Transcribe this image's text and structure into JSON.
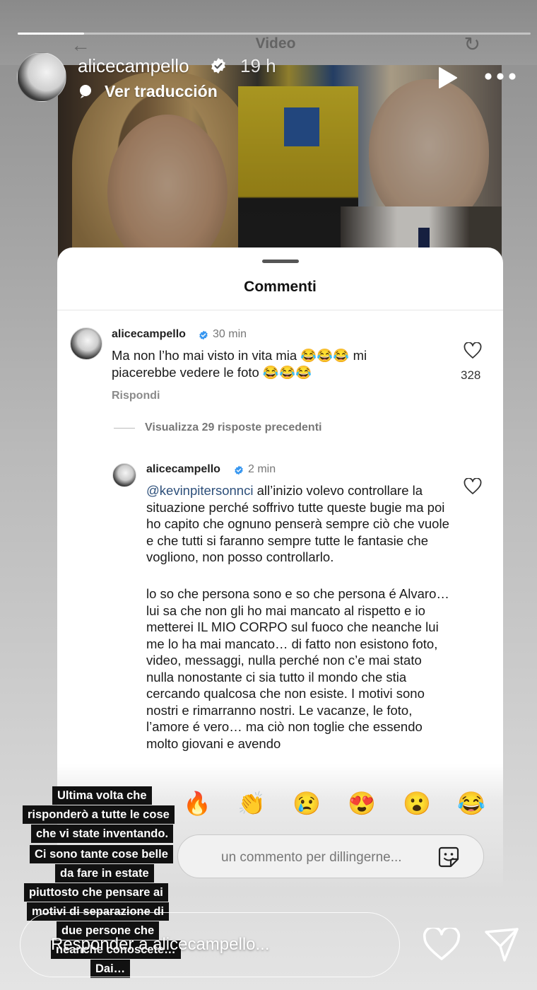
{
  "story": {
    "progress": 0.13,
    "video_label": "Video",
    "username": "alicecampello",
    "time": "19 h",
    "translate_label": "Ver traducción"
  },
  "comments_sheet": {
    "title": "Commenti",
    "comment1": {
      "username": "alicecampello",
      "time": "30 min",
      "text": "Ma non l’ho mai visto in vita mia 😂😂😂 mi piacerebbe vedere le foto 😂😂😂",
      "likes": "328",
      "reply_label": "Rispondi"
    },
    "view_replies": "Visualizza 29 risposte precedenti",
    "comment2": {
      "username": "alicecampello",
      "time": "2 min",
      "mention": "@kevinpitersonnci",
      "para1_rest": " all’inizio volevo controllare la situazione perché soffrivo tutte queste bugie ma poi ho capito che ognuno penserà sempre ciò che vuole e che tutti si faranno sempre tutte le fantasie che vogliono, non posso controllarlo.",
      "para2": "lo so che persona sono e so che persona é Alvaro… lui sa che non gli ho mai mancato al rispetto e io metterei IL MIO CORPO sul fuoco che neanche lui me lo ha mai mancato… di fatto non esistono foto, video, messaggi, nulla perché non c’e mai stato nulla nonostante ci sia tutto il mondo che stia cercando qualcosa che non esiste. I motivi sono nostri e rimarranno nostri. Le vacanze, le foto, l’amore é vero… ma ciò non toglie che essendo molto giovani e avendo"
    },
    "emojis": [
      "🔥",
      "👏",
      "😢",
      "😍",
      "😮",
      "😂"
    ],
    "input_placeholder": "un commento per dillingerne..."
  },
  "caption_lines": [
    "Ultima volta che",
    "risponderò a tutte le cose",
    "che vi state inventando.",
    "Ci sono tante cose belle",
    "da fare in estate",
    "piuttosto che pensare ai",
    "motivi di separazione di",
    "due persone che",
    "neanche conoscete…",
    "Dai…"
  ],
  "reply_bar": {
    "placeholder": "Responder a alicecampello..."
  },
  "icons": {
    "verified": "verified-badge-icon",
    "play": "play-icon",
    "more": "more-icon",
    "heart": "heart-icon",
    "send": "send-icon",
    "sticker": "sticker-icon"
  }
}
